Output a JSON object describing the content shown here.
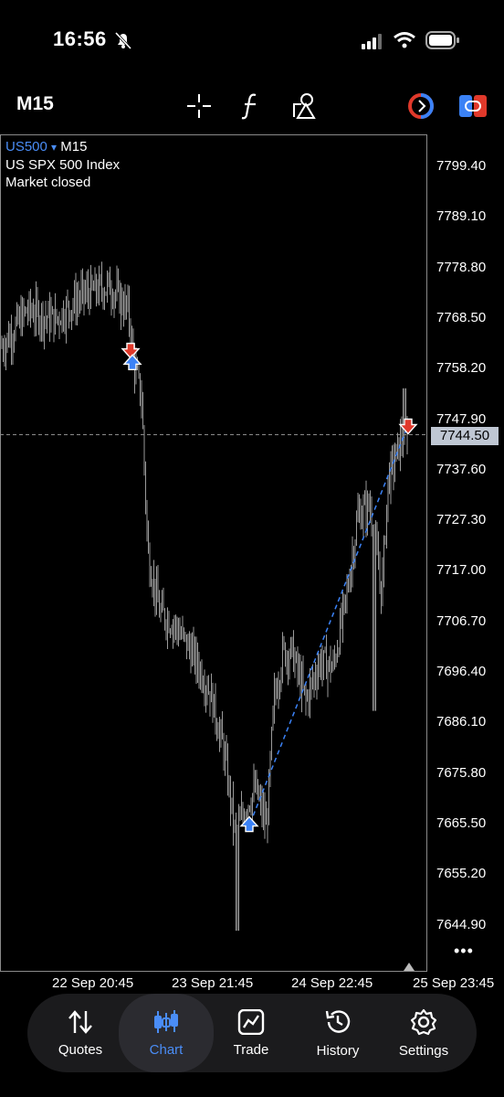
{
  "status_bar": {
    "time": "16:56"
  },
  "toolbar": {
    "timeframe": "M15"
  },
  "chart": {
    "symbol": "US500",
    "symbol_arrow": "▾",
    "timeframe": "M15",
    "description": "US SPX 500 Index",
    "market_status": "Market closed",
    "current_price": "7744.50",
    "y_labels": [
      "7799.40",
      "7789.10",
      "7778.80",
      "7768.50",
      "7758.20",
      "7747.90",
      "7737.60",
      "7727.30",
      "7717.00",
      "7706.70",
      "7696.40",
      "7686.10",
      "7675.80",
      "7665.50",
      "7655.20",
      "7644.90"
    ],
    "x_labels": [
      "22 Sep 20:45",
      "23 Sep 21:45",
      "24 Sep 22:45",
      "25 Sep 23:45"
    ],
    "more": "•••"
  },
  "chart_data": {
    "type": "line",
    "x": [
      "22 Sep 20:45",
      "23 Sep 21:45",
      "24 Sep 22:45",
      "25 Sep 23:45"
    ],
    "series": [
      {
        "values": [
          7770.5,
          7758.0,
          7700.0,
          7664.0,
          7690.0,
          7725.0,
          7744.5
        ]
      }
    ],
    "ylim": [
      7640,
      7805
    ],
    "trades": [
      {
        "type": "sell",
        "price": 7761.5
      },
      {
        "type": "buy",
        "price": 7759.5
      },
      {
        "type": "buy",
        "price": 7665.0
      },
      {
        "type": "sell",
        "price": 7746.0
      }
    ],
    "colors": {
      "sell": "#e0392b",
      "buy": "#3b82f6",
      "line": "#3b82f6",
      "candle": "#9a9a9a"
    }
  },
  "nav": {
    "items": [
      {
        "label": "Quotes"
      },
      {
        "label": "Chart"
      },
      {
        "label": "Trade"
      },
      {
        "label": "History"
      },
      {
        "label": "Settings"
      }
    ],
    "active": "Chart",
    "accent": "#4a8df6"
  }
}
